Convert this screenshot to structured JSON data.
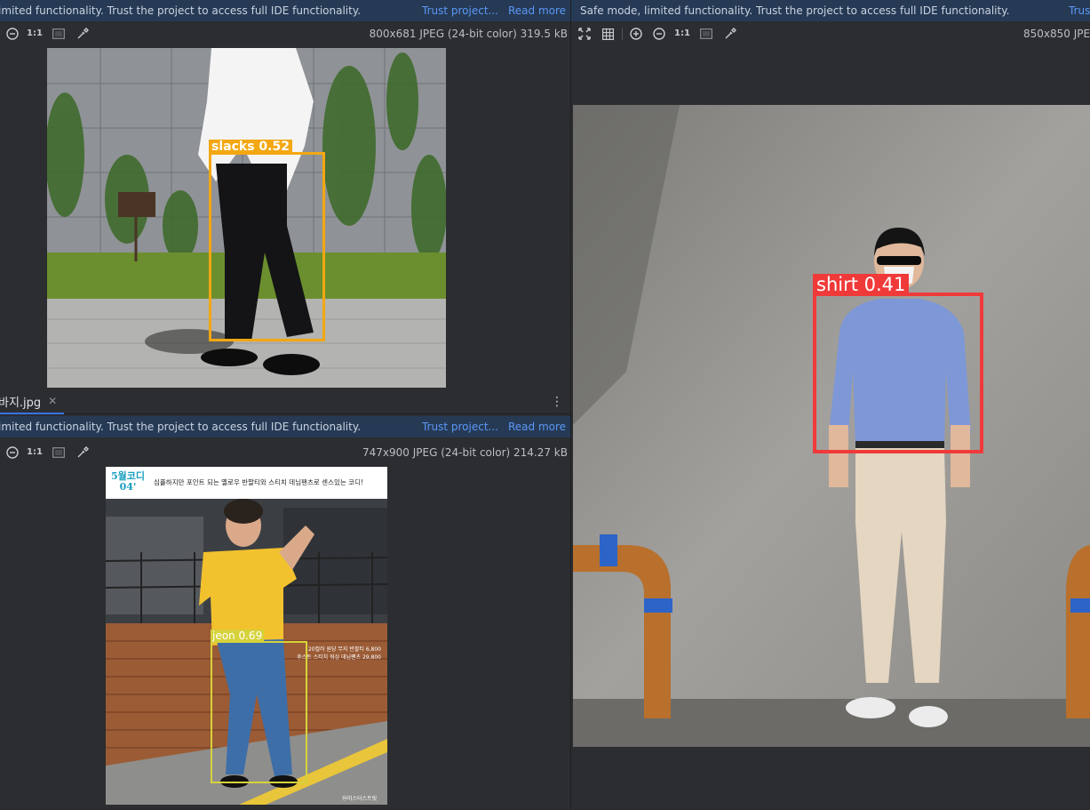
{
  "panes": {
    "top_left": {
      "banner_text": "imited functionality. Trust the project to access full IDE functionality.",
      "trust_link": "Trust project...",
      "read_more_link": "Read more",
      "image_info": "800x681 JPEG (24-bit color) 319.5 kB",
      "zoom_actual": "1:1",
      "detection": {
        "label": "slacks 0.52",
        "color": "#f3a712"
      }
    },
    "bottom_left": {
      "tab_label": "바지.jpg",
      "banner_text": "imited functionality. Trust the project to access full IDE functionality.",
      "trust_link": "Trust project...",
      "read_more_link": "Read more",
      "image_info": "747x900 JPEG (24-bit color) 214.27 kB",
      "zoom_actual": "1:1",
      "header_badge_line1": "5월코디",
      "header_badge_line2": "04'",
      "header_caption": "심플하지만 포인트 되는 옐로우 반팔티와 스티치 데님팬츠로 센스있는 코디!",
      "price_line1": "20컬러 원당 무지 반팔티 6,800",
      "price_line2": "후스트 스티치 워싱 데님팬츠 29,800",
      "watermark": "Ⓜ미스터스트릿",
      "detection": {
        "label": "jeon 0.69",
        "color": "#d6d23a"
      }
    },
    "right": {
      "banner_text": "Safe mode, limited functionality. Trust the project to access full IDE functionality.",
      "trust_link": "Trus",
      "image_info": "850x850 JPE",
      "zoom_actual": "1:1",
      "detection": {
        "label": "shirt 0.41",
        "color": "#f03a3a"
      }
    }
  },
  "icons": {
    "zoom_out": "zoom-out-icon",
    "zoom_in": "zoom-in-icon",
    "fit": "fit-to-window-icon",
    "grid": "grid-icon",
    "background": "background-icon",
    "eyedropper": "eyedropper-icon",
    "more": "more-vertical-icon"
  }
}
